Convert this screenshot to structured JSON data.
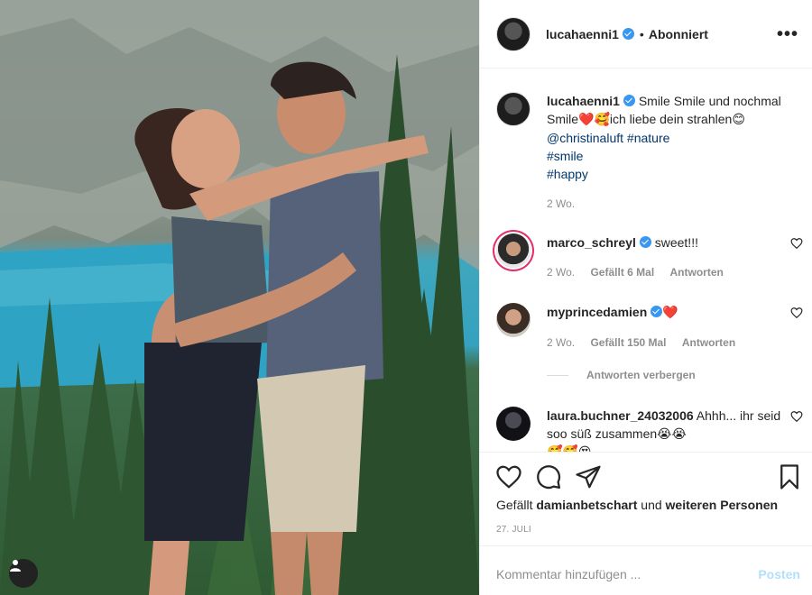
{
  "post": {
    "author": "lucahaenni1",
    "follow_status": "Abonniert",
    "separator": "•",
    "more_icon": "more-horizontal-icon"
  },
  "caption": {
    "username": "lucahaenni1",
    "text_1": "Smile Smile und nochmal Smile",
    "emoji_1": "❤️🥰",
    "text_2": "ich liebe dein strahlen",
    "emoji_2": "😊",
    "mention": "@christinaluft",
    "hashtags": [
      "#nature",
      "#smile",
      "#happy"
    ],
    "time": "2 Wo."
  },
  "comments": [
    {
      "username": "marco_schreyl",
      "verified": true,
      "text": "sweet!!!",
      "time": "2 Wo.",
      "likes": "Gefällt 6 Mal",
      "reply": "Antworten"
    },
    {
      "username": "myprincedamien",
      "verified": true,
      "text": "❤️",
      "time": "2 Wo.",
      "likes": "Gefällt 150 Mal",
      "reply": "Antworten"
    },
    {
      "username": "laura.buchner_24032006",
      "verified": false,
      "text": "Ahhh... ihr seid soo süß zusammen😭😭",
      "extra": "🥰🥰😍"
    }
  ],
  "hide_replies": "Antworten verbergen",
  "likes_line": {
    "prefix": "Gefällt",
    "user": "damianbetschart",
    "middle": "und",
    "suffix": "weiteren Personen"
  },
  "date": "27. JULI",
  "comment_input": {
    "placeholder": "Kommentar hinzufügen ...",
    "post_label": "Posten"
  },
  "colors": {
    "verified_blue": "#3897f0",
    "link": "#00376b",
    "muted": "#8e8e8e",
    "post_disabled": "#b2dffc"
  }
}
